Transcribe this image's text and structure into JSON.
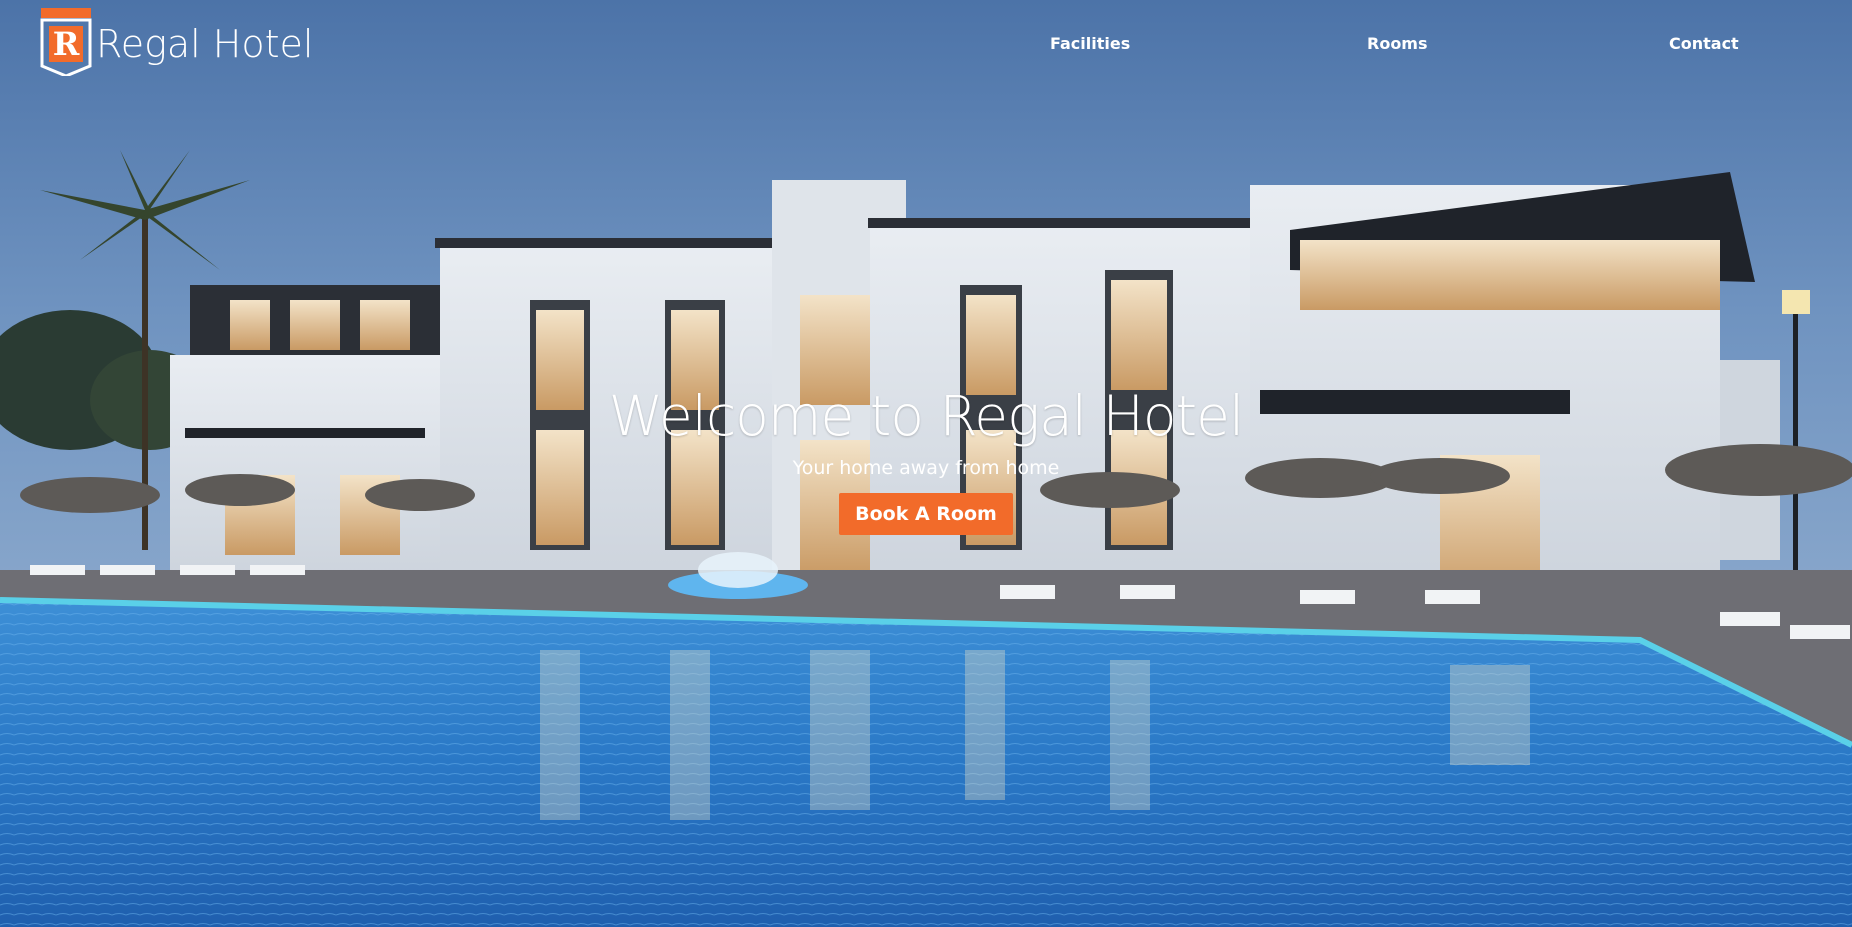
{
  "brand": {
    "logo_letter": "R",
    "name": "Regal Hotel",
    "logo_color": "#f26b2a"
  },
  "nav": {
    "items": [
      {
        "label": "Facilities"
      },
      {
        "label": "Rooms"
      },
      {
        "label": "Contact"
      }
    ]
  },
  "hero": {
    "title": "Welcome to Regal Hotel",
    "subtitle": "Your home away from home",
    "cta_label": "Book A Room",
    "accent": "#f26b2a",
    "background_image": "hotel-pool-dusk-photo"
  }
}
